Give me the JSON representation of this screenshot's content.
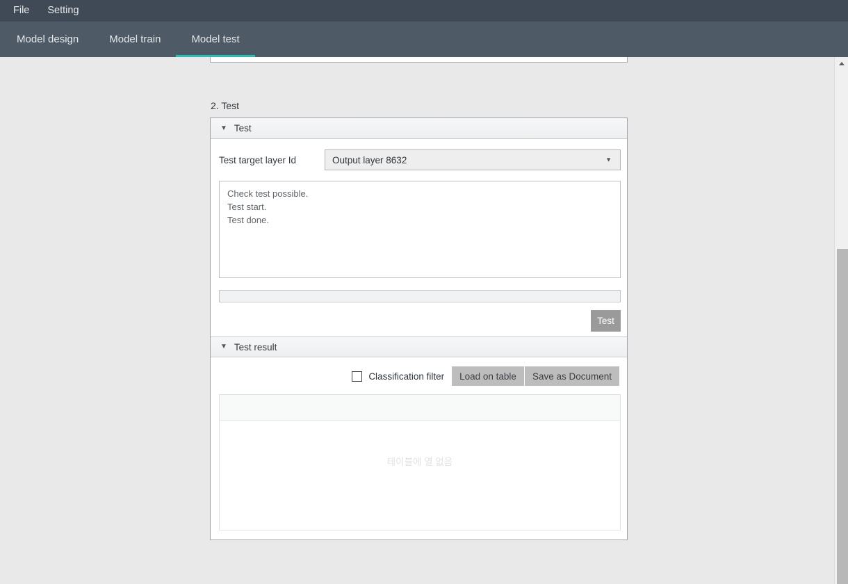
{
  "menubar": {
    "items": [
      {
        "label": "File",
        "name": "menu-file"
      },
      {
        "label": "Setting",
        "name": "menu-setting"
      }
    ]
  },
  "tabs": {
    "items": [
      {
        "label": "Model design",
        "active": false
      },
      {
        "label": "Model train",
        "active": false
      },
      {
        "label": "Model test",
        "active": true
      }
    ],
    "active_indicator_color": "#2ebcb4"
  },
  "main": {
    "section_label": "2. Test",
    "test_group": {
      "title": "Test",
      "caret": "▼",
      "layer_field": {
        "label": "Test target layer Id",
        "value": "Output layer 8632",
        "caret": "▼"
      },
      "log": {
        "lines": [
          "Check test possible.",
          "Test start.",
          "Test done."
        ]
      },
      "progress": {
        "percent": 0
      },
      "test_button_label": "Test"
    },
    "test_result_group": {
      "title": "Test result",
      "caret": "▼",
      "classification_filter": {
        "label": "Classification filter",
        "checked": false
      },
      "load_on_table_label": "Load on table",
      "save_as_document_label": "Save as Document",
      "table": {
        "columns": [],
        "rows": [],
        "empty_message": "테이블에 열 없음"
      }
    }
  },
  "scrollbar": {
    "up_arrow_icon": "chevron-up-icon"
  },
  "colors": {
    "menubar_bg": "#3f4a56",
    "tabbar_bg": "#4e5a66",
    "accent": "#2ebcb4",
    "page_bg": "#e9e9e9",
    "button_gray": "#bdbdbd",
    "test_button_gray": "#9a9a9a"
  }
}
